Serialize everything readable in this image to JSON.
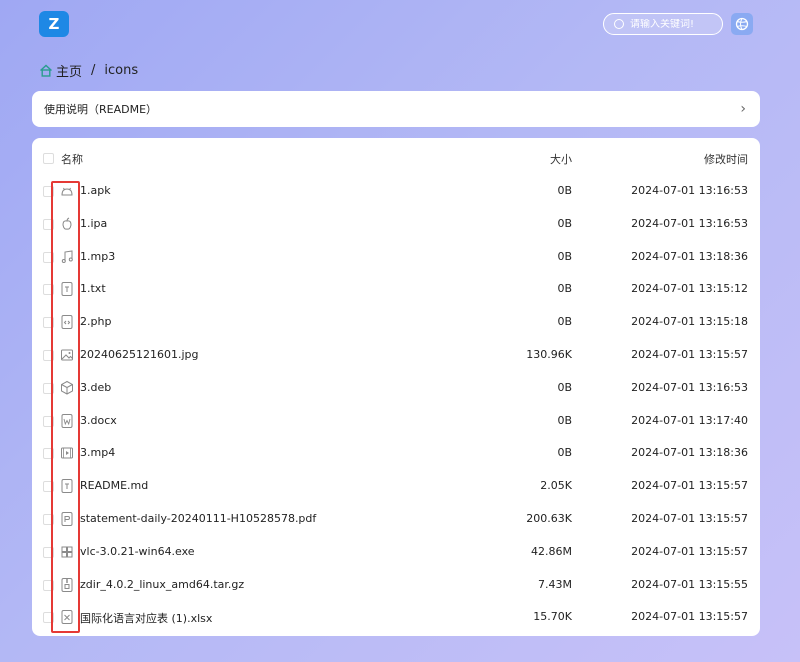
{
  "header": {
    "logo_text": "Z",
    "search_placeholder": "请输入关键词!",
    "accent": "#1e88e5"
  },
  "breadcrumb": {
    "home": "主页",
    "separator": "/",
    "current": "icons"
  },
  "readme": {
    "label": "使用说明（README）",
    "chevron": "›"
  },
  "list": {
    "columns": {
      "name": "名称",
      "size": "大小",
      "time": "修改时间"
    },
    "files": [
      {
        "name": "1.apk",
        "size": "0B",
        "time": "2024-07-01 13:16:53",
        "icon": "android-icon"
      },
      {
        "name": "1.ipa",
        "size": "0B",
        "time": "2024-07-01 13:16:53",
        "icon": "apple-icon"
      },
      {
        "name": "1.mp3",
        "size": "0B",
        "time": "2024-07-01 13:18:36",
        "icon": "music-icon"
      },
      {
        "name": "1.txt",
        "size": "0B",
        "time": "2024-07-01 13:15:12",
        "icon": "text-file-icon"
      },
      {
        "name": "2.php",
        "size": "0B",
        "time": "2024-07-01 13:15:18",
        "icon": "code-file-icon"
      },
      {
        "name": "20240625121601.jpg",
        "size": "130.96K",
        "time": "2024-07-01 13:15:57",
        "icon": "image-icon"
      },
      {
        "name": "3.deb",
        "size": "0B",
        "time": "2024-07-01 13:16:53",
        "icon": "package-icon"
      },
      {
        "name": "3.docx",
        "size": "0B",
        "time": "2024-07-01 13:17:40",
        "icon": "word-icon"
      },
      {
        "name": "3.mp4",
        "size": "0B",
        "time": "2024-07-01 13:18:36",
        "icon": "video-icon"
      },
      {
        "name": "README.md",
        "size": "2.05K",
        "time": "2024-07-01 13:15:57",
        "icon": "text-file-icon"
      },
      {
        "name": "statement-daily-20240111-H10528578.pdf",
        "size": "200.63K",
        "time": "2024-07-01 13:15:57",
        "icon": "pdf-icon"
      },
      {
        "name": "vlc-3.0.21-win64.exe",
        "size": "42.86M",
        "time": "2024-07-01 13:15:57",
        "icon": "windows-icon"
      },
      {
        "name": "zdir_4.0.2_linux_amd64.tar.gz",
        "size": "7.43M",
        "time": "2024-07-01 13:15:55",
        "icon": "archive-icon"
      },
      {
        "name": "国际化语言对应表 (1).xlsx",
        "size": "15.70K",
        "time": "2024-07-01 13:15:57",
        "icon": "excel-icon"
      }
    ]
  },
  "annotation_color": "#e53935"
}
